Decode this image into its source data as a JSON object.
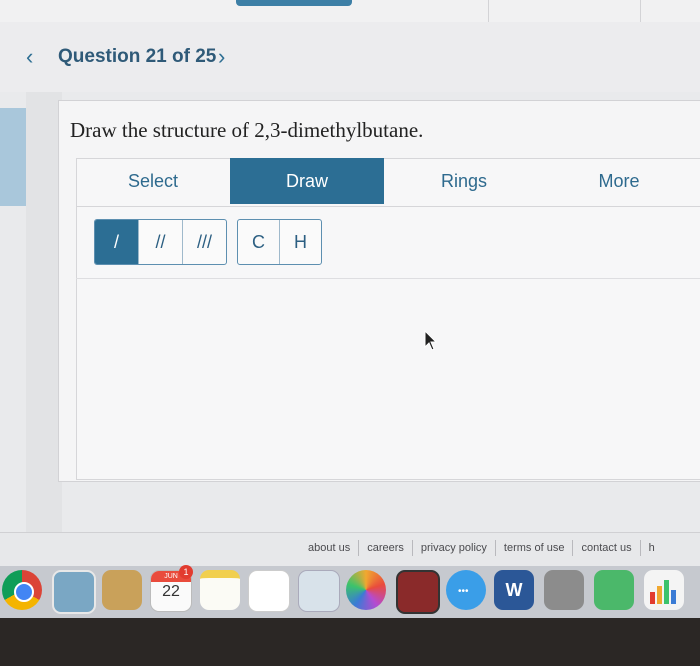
{
  "nav": {
    "prev_icon": "chevron-left-icon",
    "next_icon": "chevron-right-icon",
    "question_label": "Question 21 of 25"
  },
  "question": {
    "text": "Draw the structure of 2,3-dimethylbutane."
  },
  "editor": {
    "tabs": [
      {
        "label": "Select",
        "active": false
      },
      {
        "label": "Draw",
        "active": true
      },
      {
        "label": "Rings",
        "active": false
      },
      {
        "label": "More",
        "active": false
      }
    ],
    "bond_tools": [
      {
        "label": "/",
        "name": "single-bond",
        "active": true
      },
      {
        "label": "//",
        "name": "double-bond",
        "active": false
      },
      {
        "label": "///",
        "name": "triple-bond",
        "active": false
      }
    ],
    "atom_tools": [
      {
        "label": "C",
        "name": "carbon-atom"
      },
      {
        "label": "H",
        "name": "hydrogen-atom"
      }
    ]
  },
  "footer": {
    "links": [
      "about us",
      "careers",
      "privacy policy",
      "terms of use",
      "contact us",
      "h"
    ]
  },
  "dock": {
    "calendar_month": "JUN",
    "calendar_day": "22",
    "calendar_badge": "1",
    "word_letter": "W"
  },
  "colors": {
    "accent": "#2c6e94",
    "link": "#2e6a8e"
  }
}
